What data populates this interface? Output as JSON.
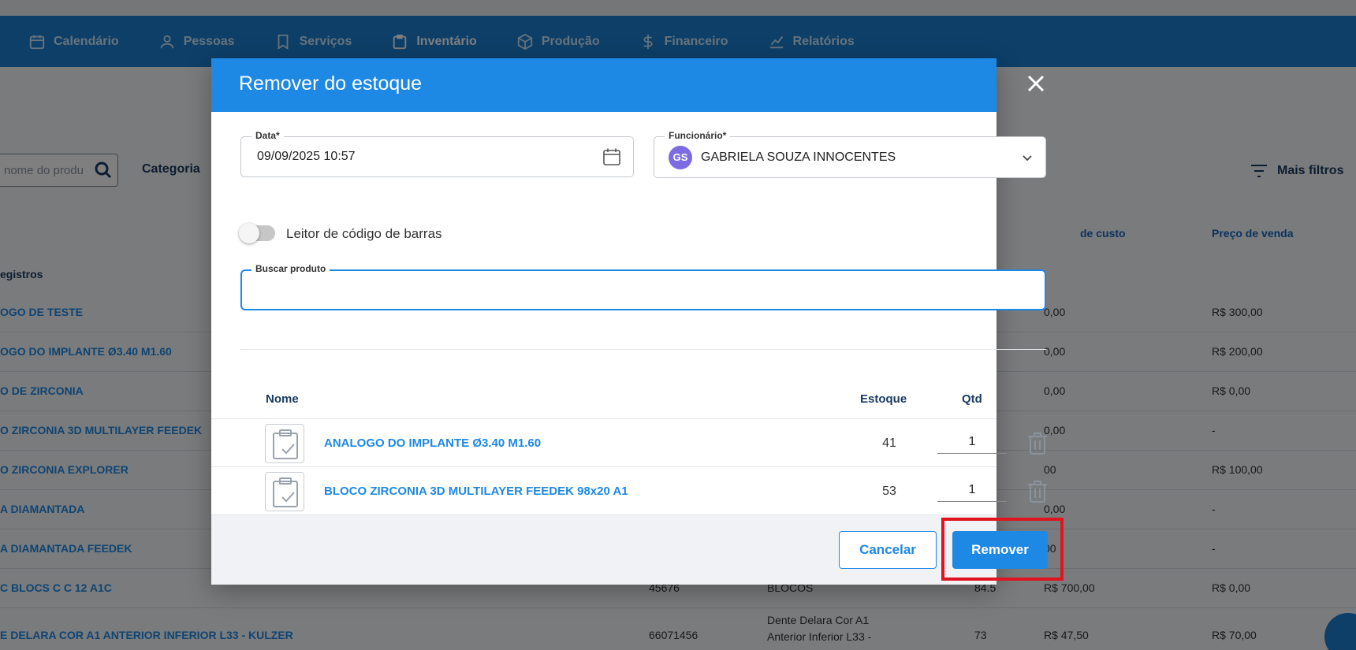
{
  "nav": {
    "items": [
      {
        "label": "Calendário",
        "icon": "calendar-icon",
        "active": false
      },
      {
        "label": "Pessoas",
        "icon": "person-icon",
        "active": false
      },
      {
        "label": "Serviços",
        "icon": "bookmark-icon",
        "active": false
      },
      {
        "label": "Inventário",
        "icon": "inventory-icon",
        "active": true
      },
      {
        "label": "Produção",
        "icon": "box-icon",
        "active": false
      },
      {
        "label": "Financeiro",
        "icon": "dollar-icon",
        "active": false
      },
      {
        "label": "Relatórios",
        "icon": "chart-icon",
        "active": false
      }
    ]
  },
  "background": {
    "search_placeholder": "nome do produ",
    "categoria_label": "Categoria",
    "filtros_label": "Mais filtros",
    "col_custo": "de custo",
    "col_venda": "Preço de venda",
    "registros": "egistros",
    "rows": [
      {
        "name": "OGO DE TESTE",
        "c1": "",
        "c2": "",
        "c3": "",
        "c4": "0,00",
        "c5": "R$ 300,00"
      },
      {
        "name": "OGO DO IMPLANTE Ø3.40 M1.60",
        "c1": "",
        "c2": "",
        "c3": "",
        "c4": "0,00",
        "c5": "R$ 200,00"
      },
      {
        "name": "O DE ZIRCONIA",
        "c1": "",
        "c2": "",
        "c3": "",
        "c4": "0,00",
        "c5": "R$ 0,00"
      },
      {
        "name": "O ZIRCONIA 3D MULTILAYER FEEDEK",
        "c1": "",
        "c2": "",
        "c3": "",
        "c4": "0,00",
        "c5": "-"
      },
      {
        "name": "O ZIRCONIA EXPLORER",
        "c1": "",
        "c2": "",
        "c3": "",
        "c4": "00",
        "c5": "R$ 100,00"
      },
      {
        "name": "A DIAMANTADA",
        "c1": "",
        "c2": "",
        "c3": "",
        "c4": "0,00",
        "c5": "-"
      },
      {
        "name": "A DIAMANTADA FEEDEK",
        "c1": "",
        "c2": "",
        "c3": "",
        "c4": "00",
        "c5": "-"
      },
      {
        "name": "C BLOCS C C 12 A1C",
        "c1": "45676",
        "c2": "BLOCOS",
        "c3": "84.5",
        "c4": "R$ 700,00",
        "c5": "R$ 0,00"
      },
      {
        "name": "E DELARA COR A1 ANTERIOR INFERIOR L33 - KULZER",
        "c1": "66071456",
        "c2": "",
        "c3": "73",
        "c4": "R$ 47,50",
        "c5": "R$ 70,00"
      }
    ],
    "desc_text": "Dente Delara Cor A1 Anterior Inferior L33 -"
  },
  "modal": {
    "title": "Remover do estoque",
    "date_label": "Data*",
    "date_value": "09/09/2025 10:57",
    "employee_label": "Funcionário*",
    "employee_initials": "GS",
    "employee_value": "GABRIELA SOUZA INNOCENTES",
    "barcode_label": "Leitor de código de barras",
    "barcode_enabled": false,
    "search_label": "Buscar produto",
    "search_value": "",
    "table": {
      "col_nome": "Nome",
      "col_estoque": "Estoque",
      "col_qtd": "Qtd",
      "rows": [
        {
          "name": "ANALOGO DO IMPLANTE Ø3.40 M1.60",
          "stock": "41",
          "qty": "1"
        },
        {
          "name": "BLOCO ZIRCONIA 3D MULTILAYER FEEDEK 98x20 A1",
          "stock": "53",
          "qty": "1"
        }
      ]
    },
    "cancel_label": "Cancelar",
    "remove_label": "Remover"
  },
  "colors": {
    "primary": "#1e88e5",
    "nav_bg": "#1a7fd1",
    "highlight": "#e0141e",
    "avatar": "#7c6be3"
  }
}
